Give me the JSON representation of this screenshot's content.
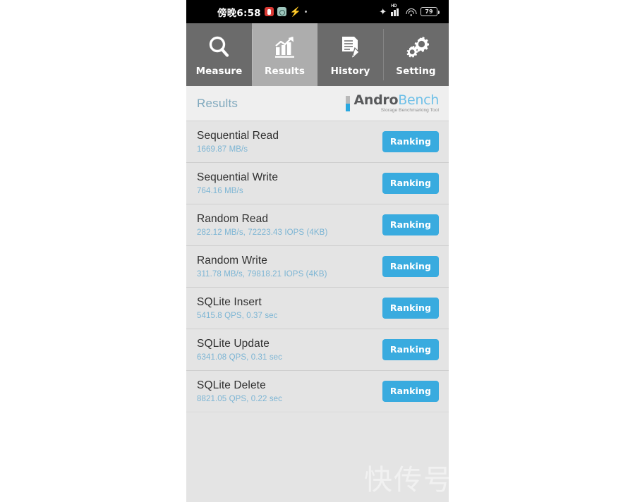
{
  "statusbar": {
    "clock": "傍晚6:58",
    "app_icons": [
      "red-app-icon",
      "teal-app-icon",
      "sync-bolt-icon",
      "dot-icon"
    ],
    "bluetooth_icon": "bluetooth-icon",
    "network_label": "HD",
    "wifi_icon": "wifi-icon",
    "battery_level": "79"
  },
  "tabs": [
    {
      "label": "Measure",
      "icon": "magnifier-icon",
      "active": false
    },
    {
      "label": "Results",
      "icon": "bar-chart-icon",
      "active": true
    },
    {
      "label": "History",
      "icon": "document-pencil-icon",
      "active": false
    },
    {
      "label": "Setting",
      "icon": "gears-icon",
      "active": false
    }
  ],
  "header": {
    "title": "Results",
    "logo_main_a": "Andro",
    "logo_main_b": "Bench",
    "logo_sub": "Storage Benchmarking Tool"
  },
  "results": {
    "button_label": "Ranking",
    "rows": [
      {
        "title": "Sequential Read",
        "value": "1669.87 MB/s"
      },
      {
        "title": "Sequential Write",
        "value": "764.16 MB/s"
      },
      {
        "title": "Random Read",
        "value": "282.12 MB/s, 72223.43 IOPS (4KB)"
      },
      {
        "title": "Random Write",
        "value": "311.78 MB/s, 79818.21 IOPS (4KB)"
      },
      {
        "title": "SQLite Insert",
        "value": "5415.8 QPS, 0.37 sec"
      },
      {
        "title": "SQLite Update",
        "value": "6341.08 QPS, 0.31 sec"
      },
      {
        "title": "SQLite Delete",
        "value": "8821.05 QPS, 0.22 sec"
      }
    ]
  },
  "watermark": {
    "text": "快传号"
  },
  "colors": {
    "accent_blue": "#39abdf",
    "logo_blue": "#6fc0e8",
    "value_blue": "#7cb5d4",
    "tabbar_gray": "#6b6b6b",
    "tab_active_gray": "#adadad",
    "row_bg": "#e4e4e4"
  }
}
